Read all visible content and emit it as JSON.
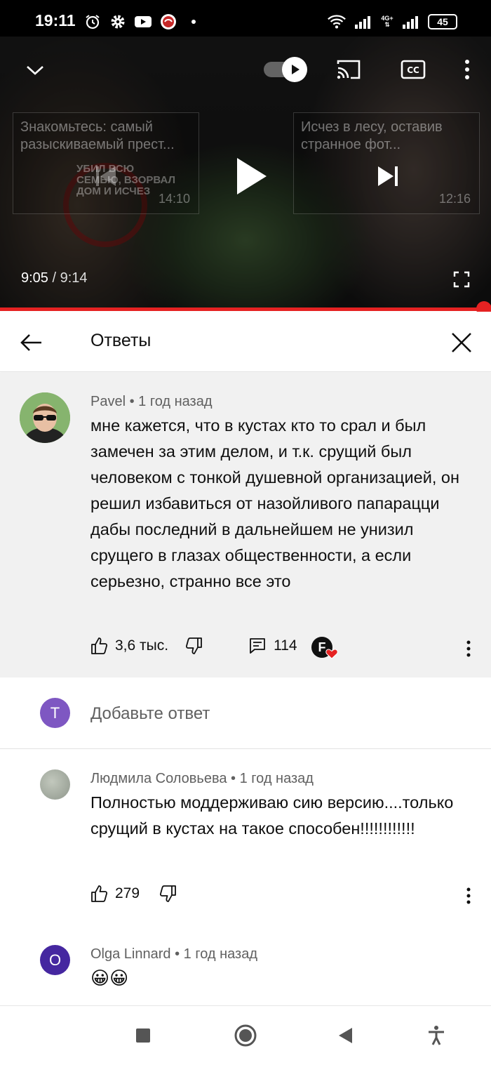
{
  "status_bar": {
    "time": "19:11",
    "battery": "45",
    "network": "4G+",
    "icons": [
      "alarm-icon",
      "gear-icon",
      "youtube-icon",
      "app-icon",
      "dot-icon",
      "wifi-icon",
      "signal-icon",
      "signal-icon",
      "battery-icon"
    ]
  },
  "player": {
    "left_thumb_title": "Знакомьтесь: самый разыскиваемый прест...",
    "left_thumb_overlay": "УБИЛ ВСЮ СЕМЬЮ, ВЗОРВАЛ ДОМ И ИСЧЕЗ",
    "left_thumb_duration": "14:10",
    "right_thumb_title": "Исчез в лесу, оставив странное фот...",
    "right_thumb_duration": "12:16",
    "current_time": "9:05",
    "separator": " / ",
    "total_time": "9:14",
    "progress": 0.985,
    "autoplay_on": true,
    "accent_color": "#e52222"
  },
  "replies_panel": {
    "title": "Ответы"
  },
  "parent_comment": {
    "author": "Pavel",
    "time": "1 год назад",
    "meta_separator": " • ",
    "text": "мне кажется, что в кустах кто то срал и был замечен за этим делом, и т.к. срущий был человеком с тонкой душевной организацией, он решил избавиться от назойливого папарацци дабы последний в дальнейшем не унизил срущего в глазах общественности,  а если серьезно, странно все это",
    "likes": "3,6 тыс.",
    "replies_count": "114",
    "creator_badge_letter": "F"
  },
  "add_reply": {
    "avatar_letter": "T",
    "avatar_color": "#7e57c2",
    "placeholder": "Добавьте ответ"
  },
  "replies": [
    {
      "author": "Людмила Соловьева",
      "time": "1 год назад",
      "text": "Полностью моддерживаю сию версию....только срущий в кустах на такое способен!!!!!!!!!!!!",
      "likes": "279"
    },
    {
      "author": "Olga Linnard",
      "time": "1 год назад",
      "text": "😀😀",
      "avatar_letter": "O",
      "avatar_color": "#4527a0"
    }
  ],
  "nav_bar": {
    "buttons": [
      "recents-icon",
      "home-icon",
      "back-icon",
      "accessibility-icon"
    ]
  }
}
